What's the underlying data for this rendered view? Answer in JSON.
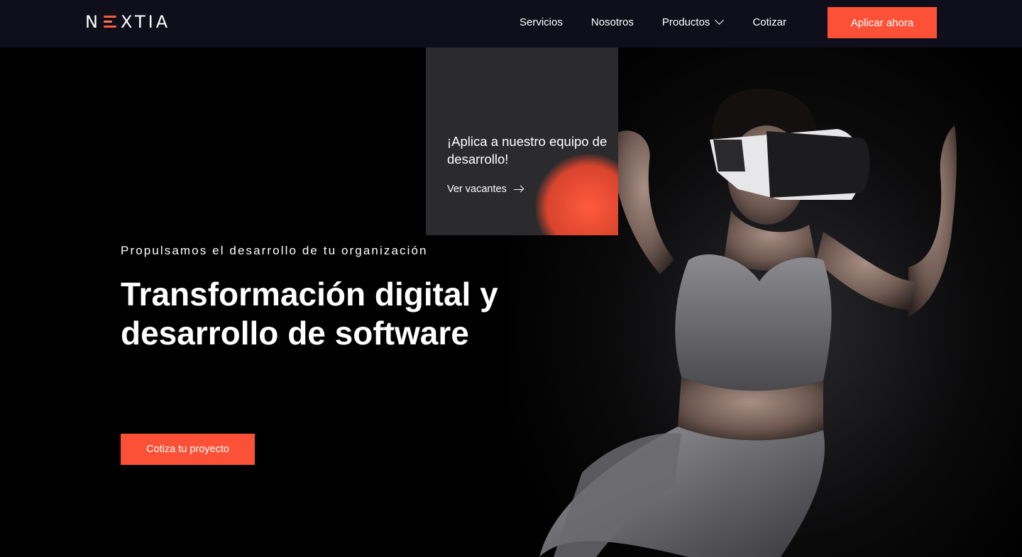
{
  "brand": {
    "name": "NEXTIA",
    "accent": "#fc5136"
  },
  "nav": {
    "links": [
      "Servicios",
      "Nosotros",
      "Productos",
      "Cotizar"
    ],
    "cta": "Aplicar ahora"
  },
  "promo": {
    "title": "¡Aplica a nuestro equipo de desarrollo!",
    "link": "Ver vacantes"
  },
  "hero": {
    "tagline": "Propulsamos el desarrollo de tu organización",
    "headline": "Transformación digital y desarrollo de software",
    "cta": "Cotiza tu proyecto",
    "image_alt": "woman with VR headset running"
  }
}
